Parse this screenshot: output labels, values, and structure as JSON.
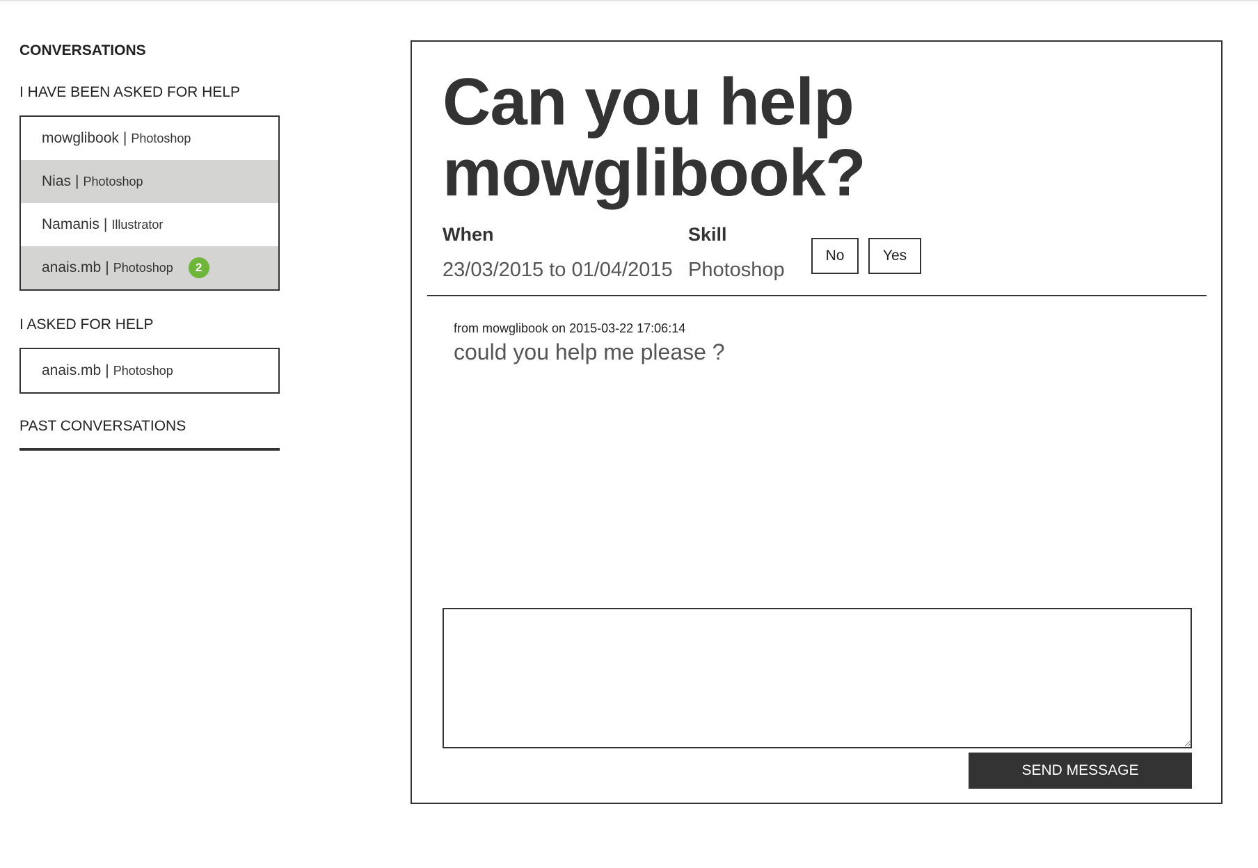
{
  "sidebar": {
    "title": "CONVERSATIONS",
    "asked_me": {
      "heading": "I HAVE BEEN ASKED FOR HELP",
      "items": [
        {
          "user": "mowglibook",
          "separator": "|",
          "skill": "Photoshop",
          "badge": ""
        },
        {
          "user": "Nias",
          "separator": "|",
          "skill": "Photoshop",
          "badge": ""
        },
        {
          "user": "Namanis",
          "separator": "|",
          "skill": "Illustrator",
          "badge": ""
        },
        {
          "user": "anais.mb",
          "separator": "|",
          "skill": "Photoshop",
          "badge": "2"
        }
      ]
    },
    "i_asked": {
      "heading": "I ASKED FOR HELP",
      "items": [
        {
          "user": "anais.mb",
          "separator": "|",
          "skill": "Photoshop"
        }
      ]
    },
    "past": {
      "heading": "PAST CONVERSATIONS"
    }
  },
  "main": {
    "headline": "Can you help mowglibook?",
    "when_label": "When",
    "when_value": "23/03/2015 to 01/04/2015",
    "skill_label": "Skill",
    "skill_value": "Photoshop",
    "no_label": "No",
    "yes_label": "Yes",
    "messages": [
      {
        "meta": "from mowglibook on 2015-03-22 17:06:14",
        "text": "could you help me please ?"
      }
    ],
    "reply_value": "",
    "send_label": "SEND MESSAGE"
  },
  "colors": {
    "dark": "#333333",
    "shaded_row": "#d4d4d2",
    "badge": "#6fb53a"
  }
}
